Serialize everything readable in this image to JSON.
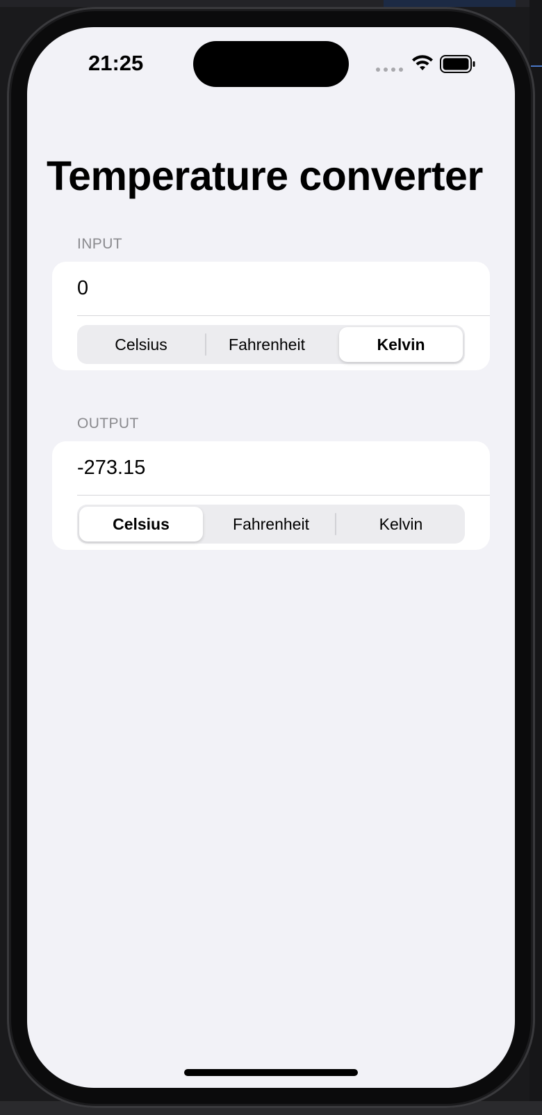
{
  "status_bar": {
    "time": "21:25",
    "icons": [
      "signal-dots-icon",
      "wifi-icon",
      "battery-icon"
    ]
  },
  "screen": {
    "title": "Temperature converter"
  },
  "input_section": {
    "header": "INPUT",
    "value": "0",
    "units": [
      "Celsius",
      "Fahrenheit",
      "Kelvin"
    ],
    "selected_unit": "Kelvin"
  },
  "output_section": {
    "header": "OUTPUT",
    "value": "-273.15",
    "units": [
      "Celsius",
      "Fahrenheit",
      "Kelvin"
    ],
    "selected_unit": "Celsius"
  },
  "colors": {
    "background": "#f2f2f7",
    "card": "#ffffff",
    "segment_track": "#ececef",
    "secondary_text": "#8a8a8e"
  }
}
